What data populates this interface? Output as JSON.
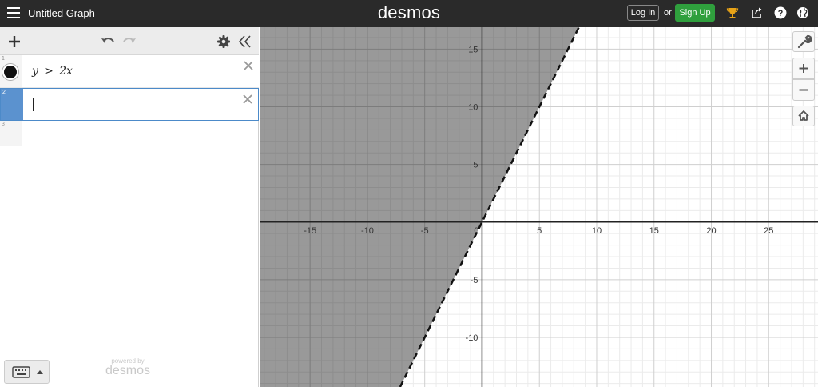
{
  "header": {
    "title": "Untitled Graph",
    "logo": "desmos",
    "login_label": "Log In",
    "or_label": "or",
    "signup_label": "Sign Up"
  },
  "expressions": [
    {
      "number": "1",
      "latex": "y > 2x",
      "color": "#000000",
      "inequality": "strict",
      "shading": "above"
    },
    {
      "number": "2",
      "latex": ""
    },
    {
      "number": "3"
    }
  ],
  "footer": {
    "powered_by": "powered by",
    "brand": "desmos"
  },
  "graph": {
    "x_ticks": [
      "-15",
      "-10",
      "-5",
      "0",
      "5",
      "10",
      "15",
      "20",
      "25"
    ],
    "y_ticks": [
      "15",
      "10",
      "5",
      "-5",
      "-10"
    ],
    "x_range": [
      -19.4,
      29.3
    ],
    "y_range": [
      -14.3,
      16.9
    ]
  },
  "colors": {
    "header_bg": "#2a2a2a",
    "signup_green": "#2f9f3d",
    "trophy_gold": "#e8a317",
    "shade_fill": "#000000",
    "active_blue": "#5b92cf"
  }
}
